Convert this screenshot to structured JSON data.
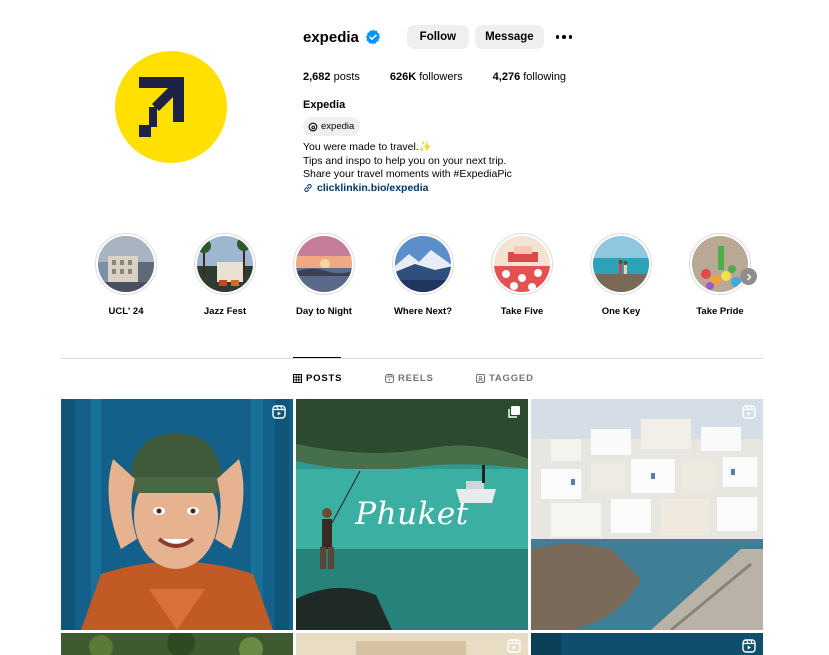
{
  "profile": {
    "username": "expedia",
    "follow_label": "Follow",
    "message_label": "Message",
    "stats": {
      "posts_count": "2,682",
      "posts_label": "posts",
      "followers_count": "626K",
      "followers_label": "followers",
      "following_count": "4,276",
      "following_label": "following"
    },
    "full_name": "Expedia",
    "threads_handle": "expedia",
    "bio": [
      "You were made to travel.✨",
      "Tips and inspo to help you on your next trip.",
      "Share your travel moments with #ExpediaPic"
    ],
    "link": "clicklinkin.bio/expedia"
  },
  "highlights": [
    {
      "label": "UCL' 24"
    },
    {
      "label": "Jazz Fest"
    },
    {
      "label": "Day to Night"
    },
    {
      "label": "Where Next?"
    },
    {
      "label": "Take Five"
    },
    {
      "label": "One Key"
    },
    {
      "label": "Take Pride"
    }
  ],
  "tabs": [
    {
      "label": "POSTS",
      "active": true
    },
    {
      "label": "REELS",
      "active": false
    },
    {
      "label": "TAGGED",
      "active": false
    }
  ],
  "posts": [
    {
      "type": "reel",
      "overlay_text": ""
    },
    {
      "type": "carousel",
      "overlay_text": "Phuket"
    },
    {
      "type": "reel",
      "overlay_text": ""
    }
  ],
  "colors": {
    "brand_yellow": "#ffe000",
    "brand_navy": "#1c2145",
    "link": "#00376b",
    "verified": "#0095f6"
  }
}
